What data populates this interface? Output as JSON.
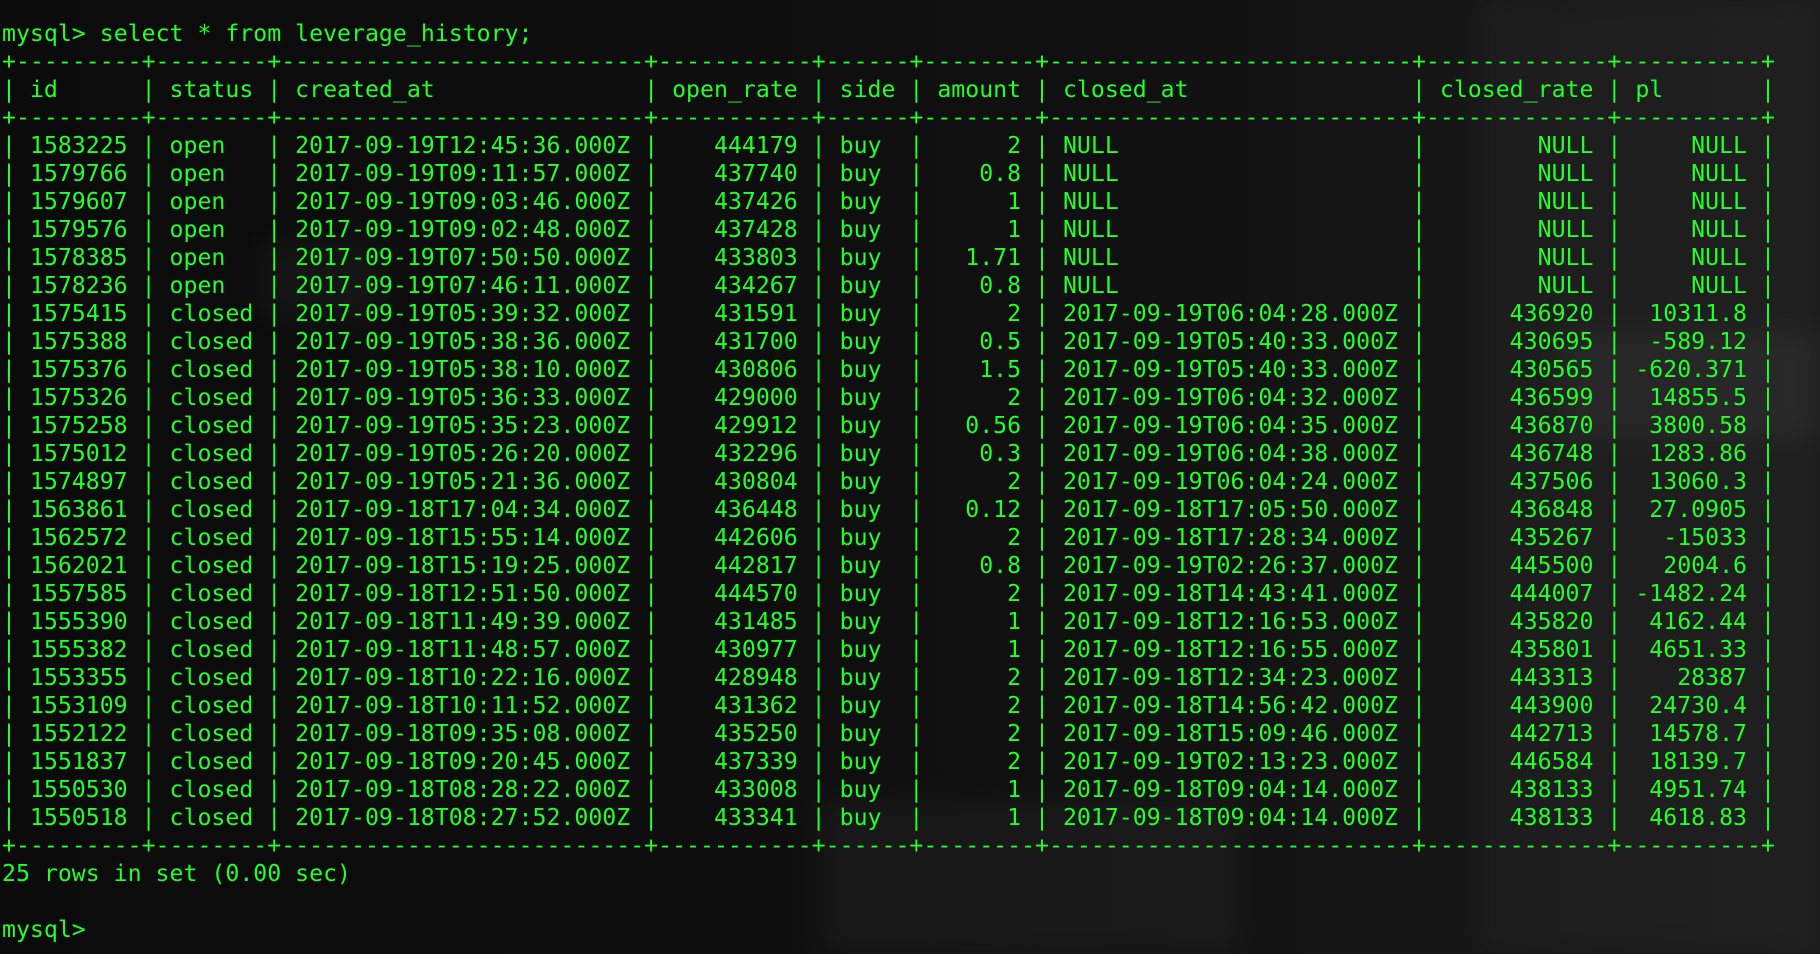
{
  "prompt": "mysql>",
  "command": "select * from leverage_history;",
  "headers": [
    "id",
    "status",
    "created_at",
    "open_rate",
    "side",
    "amount",
    "closed_at",
    "closed_rate",
    "pl"
  ],
  "rows": [
    [
      "1583225",
      "open",
      "2017-09-19T12:45:36.000Z",
      "444179",
      "buy",
      "2",
      "NULL",
      "NULL",
      "NULL"
    ],
    [
      "1579766",
      "open",
      "2017-09-19T09:11:57.000Z",
      "437740",
      "buy",
      "0.8",
      "NULL",
      "NULL",
      "NULL"
    ],
    [
      "1579607",
      "open",
      "2017-09-19T09:03:46.000Z",
      "437426",
      "buy",
      "1",
      "NULL",
      "NULL",
      "NULL"
    ],
    [
      "1579576",
      "open",
      "2017-09-19T09:02:48.000Z",
      "437428",
      "buy",
      "1",
      "NULL",
      "NULL",
      "NULL"
    ],
    [
      "1578385",
      "open",
      "2017-09-19T07:50:50.000Z",
      "433803",
      "buy",
      "1.71",
      "NULL",
      "NULL",
      "NULL"
    ],
    [
      "1578236",
      "open",
      "2017-09-19T07:46:11.000Z",
      "434267",
      "buy",
      "0.8",
      "NULL",
      "NULL",
      "NULL"
    ],
    [
      "1575415",
      "closed",
      "2017-09-19T05:39:32.000Z",
      "431591",
      "buy",
      "2",
      "2017-09-19T06:04:28.000Z",
      "436920",
      "10311.8"
    ],
    [
      "1575388",
      "closed",
      "2017-09-19T05:38:36.000Z",
      "431700",
      "buy",
      "0.5",
      "2017-09-19T05:40:33.000Z",
      "430695",
      "-589.12"
    ],
    [
      "1575376",
      "closed",
      "2017-09-19T05:38:10.000Z",
      "430806",
      "buy",
      "1.5",
      "2017-09-19T05:40:33.000Z",
      "430565",
      "-620.371"
    ],
    [
      "1575326",
      "closed",
      "2017-09-19T05:36:33.000Z",
      "429000",
      "buy",
      "2",
      "2017-09-19T06:04:32.000Z",
      "436599",
      "14855.5"
    ],
    [
      "1575258",
      "closed",
      "2017-09-19T05:35:23.000Z",
      "429912",
      "buy",
      "0.56",
      "2017-09-19T06:04:35.000Z",
      "436870",
      "3800.58"
    ],
    [
      "1575012",
      "closed",
      "2017-09-19T05:26:20.000Z",
      "432296",
      "buy",
      "0.3",
      "2017-09-19T06:04:38.000Z",
      "436748",
      "1283.86"
    ],
    [
      "1574897",
      "closed",
      "2017-09-19T05:21:36.000Z",
      "430804",
      "buy",
      "2",
      "2017-09-19T06:04:24.000Z",
      "437506",
      "13060.3"
    ],
    [
      "1563861",
      "closed",
      "2017-09-18T17:04:34.000Z",
      "436448",
      "buy",
      "0.12",
      "2017-09-18T17:05:50.000Z",
      "436848",
      "27.0905"
    ],
    [
      "1562572",
      "closed",
      "2017-09-18T15:55:14.000Z",
      "442606",
      "buy",
      "2",
      "2017-09-18T17:28:34.000Z",
      "435267",
      "-15033"
    ],
    [
      "1562021",
      "closed",
      "2017-09-18T15:19:25.000Z",
      "442817",
      "buy",
      "0.8",
      "2017-09-19T02:26:37.000Z",
      "445500",
      "2004.6"
    ],
    [
      "1557585",
      "closed",
      "2017-09-18T12:51:50.000Z",
      "444570",
      "buy",
      "2",
      "2017-09-18T14:43:41.000Z",
      "444007",
      "-1482.24"
    ],
    [
      "1555390",
      "closed",
      "2017-09-18T11:49:39.000Z",
      "431485",
      "buy",
      "1",
      "2017-09-18T12:16:53.000Z",
      "435820",
      "4162.44"
    ],
    [
      "1555382",
      "closed",
      "2017-09-18T11:48:57.000Z",
      "430977",
      "buy",
      "1",
      "2017-09-18T12:16:55.000Z",
      "435801",
      "4651.33"
    ],
    [
      "1553355",
      "closed",
      "2017-09-18T10:22:16.000Z",
      "428948",
      "buy",
      "2",
      "2017-09-18T12:34:23.000Z",
      "443313",
      "28387"
    ],
    [
      "1553109",
      "closed",
      "2017-09-18T10:11:52.000Z",
      "431362",
      "buy",
      "2",
      "2017-09-18T14:56:42.000Z",
      "443900",
      "24730.4"
    ],
    [
      "1552122",
      "closed",
      "2017-09-18T09:35:08.000Z",
      "435250",
      "buy",
      "2",
      "2017-09-18T15:09:46.000Z",
      "442713",
      "14578.7"
    ],
    [
      "1551837",
      "closed",
      "2017-09-18T09:20:45.000Z",
      "437339",
      "buy",
      "2",
      "2017-09-19T02:13:23.000Z",
      "446584",
      "18139.7"
    ],
    [
      "1550530",
      "closed",
      "2017-09-18T08:28:22.000Z",
      "433008",
      "buy",
      "1",
      "2017-09-18T09:04:14.000Z",
      "438133",
      "4951.74"
    ],
    [
      "1550518",
      "closed",
      "2017-09-18T08:27:52.000Z",
      "433341",
      "buy",
      "1",
      "2017-09-18T09:04:14.000Z",
      "438133",
      "4618.83"
    ]
  ],
  "result_summary": "25 rows in set (0.00 sec)",
  "colors": {
    "text": "#23ff2b",
    "background": "#0c0c0c"
  }
}
